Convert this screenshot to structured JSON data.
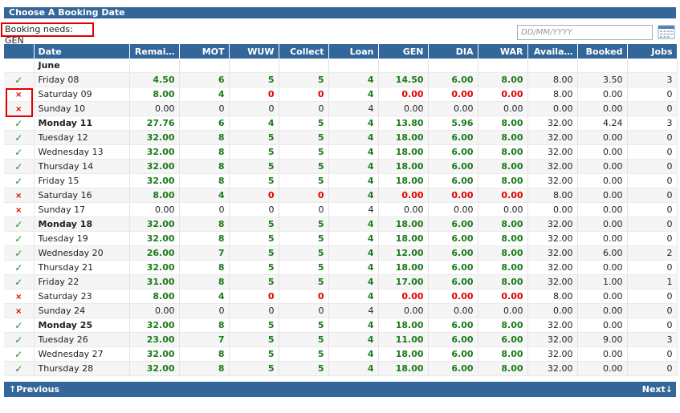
{
  "title": "Choose A Booking Date",
  "booking_needs": "Booking needs: GEN",
  "date_input": {
    "placeholder": "DD/MM/YYYY",
    "value": ""
  },
  "icons": {
    "calendar": "calendar-icon",
    "available": "check-icon",
    "unavailable": "cross-icon"
  },
  "colors": {
    "header": "#336699",
    "green": "#1a7a1a",
    "red": "#e00000"
  },
  "columns": [
    "",
    "Date",
    "Remai…",
    "MOT",
    "WUW",
    "Collect",
    "Loan",
    "GEN",
    "DIA",
    "WAR",
    "Availa…",
    "Booked",
    "Jobs"
  ],
  "month": "June",
  "rows": [
    {
      "s": "ok",
      "date": "Friday 08",
      "bold": false,
      "v": [
        "4.50",
        "6",
        "5",
        "5",
        "4",
        "14.50",
        "6.00",
        "8.00",
        "8.00",
        "3.50",
        "3"
      ]
    },
    {
      "s": "no",
      "date": "Saturday 09",
      "bold": false,
      "v": [
        "8.00",
        "4",
        "0",
        "0",
        "4",
        "0.00",
        "0.00",
        "0.00",
        "8.00",
        "0.00",
        "0"
      ]
    },
    {
      "s": "no",
      "date": "Sunday 10",
      "bold": false,
      "v": [
        "0.00",
        "0",
        "0",
        "0",
        "4",
        "0.00",
        "0.00",
        "0.00",
        "0.00",
        "0.00",
        "0"
      ]
    },
    {
      "s": "ok",
      "date": "Monday 11",
      "bold": true,
      "v": [
        "27.76",
        "6",
        "4",
        "5",
        "4",
        "13.80",
        "5.96",
        "8.00",
        "32.00",
        "4.24",
        "3"
      ]
    },
    {
      "s": "ok",
      "date": "Tuesday 12",
      "bold": false,
      "v": [
        "32.00",
        "8",
        "5",
        "5",
        "4",
        "18.00",
        "6.00",
        "8.00",
        "32.00",
        "0.00",
        "0"
      ]
    },
    {
      "s": "ok",
      "date": "Wednesday 13",
      "bold": false,
      "v": [
        "32.00",
        "8",
        "5",
        "5",
        "4",
        "18.00",
        "6.00",
        "8.00",
        "32.00",
        "0.00",
        "0"
      ]
    },
    {
      "s": "ok",
      "date": "Thursday 14",
      "bold": false,
      "v": [
        "32.00",
        "8",
        "5",
        "5",
        "4",
        "18.00",
        "6.00",
        "8.00",
        "32.00",
        "0.00",
        "0"
      ]
    },
    {
      "s": "ok",
      "date": "Friday 15",
      "bold": false,
      "v": [
        "32.00",
        "8",
        "5",
        "5",
        "4",
        "18.00",
        "6.00",
        "8.00",
        "32.00",
        "0.00",
        "0"
      ]
    },
    {
      "s": "no",
      "date": "Saturday 16",
      "bold": false,
      "v": [
        "8.00",
        "4",
        "0",
        "0",
        "4",
        "0.00",
        "0.00",
        "0.00",
        "8.00",
        "0.00",
        "0"
      ]
    },
    {
      "s": "no",
      "date": "Sunday 17",
      "bold": false,
      "v": [
        "0.00",
        "0",
        "0",
        "0",
        "4",
        "0.00",
        "0.00",
        "0.00",
        "0.00",
        "0.00",
        "0"
      ]
    },
    {
      "s": "ok",
      "date": "Monday 18",
      "bold": true,
      "v": [
        "32.00",
        "8",
        "5",
        "5",
        "4",
        "18.00",
        "6.00",
        "8.00",
        "32.00",
        "0.00",
        "0"
      ]
    },
    {
      "s": "ok",
      "date": "Tuesday 19",
      "bold": false,
      "v": [
        "32.00",
        "8",
        "5",
        "5",
        "4",
        "18.00",
        "6.00",
        "8.00",
        "32.00",
        "0.00",
        "0"
      ]
    },
    {
      "s": "ok",
      "date": "Wednesday 20",
      "bold": false,
      "v": [
        "26.00",
        "7",
        "5",
        "5",
        "4",
        "12.00",
        "6.00",
        "8.00",
        "32.00",
        "6.00",
        "2"
      ]
    },
    {
      "s": "ok",
      "date": "Thursday 21",
      "bold": false,
      "v": [
        "32.00",
        "8",
        "5",
        "5",
        "4",
        "18.00",
        "6.00",
        "8.00",
        "32.00",
        "0.00",
        "0"
      ]
    },
    {
      "s": "ok",
      "date": "Friday 22",
      "bold": false,
      "v": [
        "31.00",
        "8",
        "5",
        "5",
        "4",
        "17.00",
        "6.00",
        "8.00",
        "32.00",
        "1.00",
        "1"
      ]
    },
    {
      "s": "no",
      "date": "Saturday 23",
      "bold": false,
      "v": [
        "8.00",
        "4",
        "0",
        "0",
        "4",
        "0.00",
        "0.00",
        "0.00",
        "8.00",
        "0.00",
        "0"
      ]
    },
    {
      "s": "no",
      "date": "Sunday 24",
      "bold": false,
      "v": [
        "0.00",
        "0",
        "0",
        "0",
        "4",
        "0.00",
        "0.00",
        "0.00",
        "0.00",
        "0.00",
        "0"
      ]
    },
    {
      "s": "ok",
      "date": "Monday 25",
      "bold": true,
      "v": [
        "32.00",
        "8",
        "5",
        "5",
        "4",
        "18.00",
        "6.00",
        "8.00",
        "32.00",
        "0.00",
        "0"
      ]
    },
    {
      "s": "ok",
      "date": "Tuesday 26",
      "bold": false,
      "v": [
        "23.00",
        "7",
        "5",
        "5",
        "4",
        "11.00",
        "6.00",
        "6.00",
        "32.00",
        "9.00",
        "3"
      ]
    },
    {
      "s": "ok",
      "date": "Wednesday 27",
      "bold": false,
      "v": [
        "32.00",
        "8",
        "5",
        "5",
        "4",
        "18.00",
        "6.00",
        "8.00",
        "32.00",
        "0.00",
        "0"
      ]
    },
    {
      "s": "ok",
      "date": "Thursday 28",
      "bold": false,
      "v": [
        "32.00",
        "8",
        "5",
        "5",
        "4",
        "18.00",
        "6.00",
        "8.00",
        "32.00",
        "0.00",
        "0"
      ]
    }
  ],
  "footer": {
    "prev": "↑Previous",
    "next": "Next↓"
  }
}
